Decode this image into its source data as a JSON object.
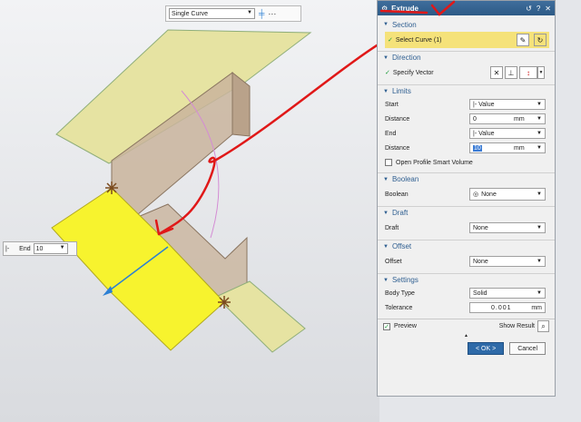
{
  "toolbar": {
    "curve_rule": "Single Curve",
    "icons": [
      "curve-rule-icon",
      "more-icon"
    ]
  },
  "end_float": {
    "icon": "|-",
    "label": "End",
    "value": "10"
  },
  "dialog": {
    "title": "Extrude",
    "title_buttons": [
      "↺",
      "?",
      "✕"
    ],
    "section": {
      "heading": "Section",
      "select_curve_label": "Select Curve (1)"
    },
    "direction": {
      "heading": "Direction",
      "specify_vector_label": "Specify Vector"
    },
    "limits": {
      "heading": "Limits",
      "start_label": "Start",
      "start_value": "|- Value",
      "distance1_label": "Distance",
      "distance1_value": "0",
      "distance1_unit": "mm",
      "end_label": "End",
      "end_value": "|- Value",
      "distance2_label": "Distance",
      "distance2_value": "10",
      "distance2_unit": "mm",
      "open_profile_label": "Open Profile Smart Volume"
    },
    "boolean": {
      "heading": "Boolean",
      "label": "Boolean",
      "value": "None"
    },
    "draft": {
      "heading": "Draft",
      "label": "Draft",
      "value": "None"
    },
    "offset": {
      "heading": "Offset",
      "label": "Offset",
      "value": "None"
    },
    "settings": {
      "heading": "Settings",
      "body_type_label": "Body Type",
      "body_type_value": "Solid",
      "tolerance_label": "Tolerance",
      "tolerance_value": "0.001",
      "tolerance_unit": "mm"
    },
    "footer": {
      "preview_label": "Preview",
      "show_result_label": "Show Result",
      "ok_label": "< OK >",
      "cancel_label": "Cancel"
    }
  },
  "colors": {
    "surface_pale": "#e6e3a2",
    "surface_yellow": "#f7f32e",
    "wall": "#c9b49c",
    "annotation_red": "#e01818",
    "title_blue": "#2d5a86"
  }
}
